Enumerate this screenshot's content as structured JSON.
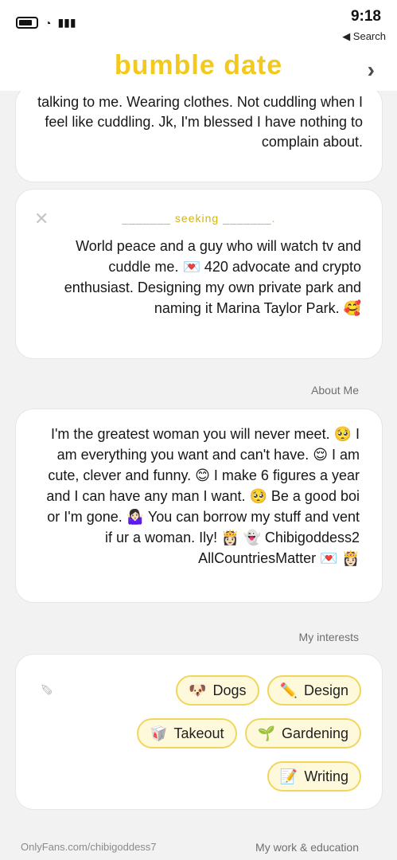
{
  "status": {
    "time": "9:18",
    "back_label": "◀ Search"
  },
  "brand": {
    "name": "bumble date"
  },
  "cards": {
    "top_text": "talking to me. Wearing clothes. Not cuddling when I feel like cuddling. Jk, I'm blessed I have nothing to complain about.",
    "seeking_label": "_______ seeking _______.",
    "seeking_text": "World peace and a guy who will watch tv and cuddle me. 💌 420 advocate and crypto enthusiast. Designing my own private park and naming it Marina Taylor Park. 🥰",
    "about_label": "About Me",
    "about_text": "I'm the greatest woman you will never meet. 🥺 I am everything you want and can't have. 😌 I am cute, clever and funny. 😊 I make 6 figures a year and I can have any man I want. 🥺 Be a good boi or I'm gone. 🤷🏻‍♀️ You can borrow my stuff and vent if ur a woman. Ily! 👸🏻 👻 Chibigoddess2 AllCountriesMatter 💌 👸🏻"
  },
  "interests": {
    "label": "My interests",
    "chips": [
      {
        "emoji": "✏️",
        "label": "Design"
      },
      {
        "emoji": "🐶",
        "label": "Dogs"
      },
      {
        "emoji": "🌱",
        "label": "Gardening"
      },
      {
        "emoji": "🥡",
        "label": "Takeout"
      },
      {
        "emoji": "📝",
        "label": "Writing"
      }
    ]
  },
  "work_label": "My work & education",
  "watermark": "OnlyFans.com/chibigoddess7",
  "icons": [
    "battery-icon",
    "wifi-icon",
    "signal-icon",
    "chevron-left-icon",
    "close-icon",
    "pencil-icon"
  ]
}
